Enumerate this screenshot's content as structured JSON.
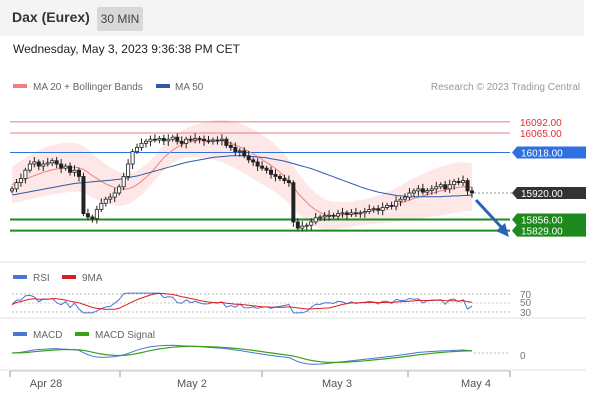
{
  "header": {
    "instrument": "Dax (Eurex)",
    "timeframe": "30 MIN",
    "timestamp": "Wednesday, May 3, 2023 9:36:38 PM CET"
  },
  "legend": {
    "ma20_label": "MA 20 + Bollinger Bands",
    "ma50_label": "MA 50",
    "ma20_color": "#f08080",
    "ma50_color": "#2e5aa8",
    "copyright": "Research © 2023 Trading Central"
  },
  "rsi_panel": {
    "rsi_label": "RSI",
    "ma_label": "9MA",
    "rsi_color": "#4a74d6",
    "ma_color": "#d62020",
    "levels": [
      "70",
      "50",
      "30"
    ]
  },
  "macd_panel": {
    "macd_label": "MACD",
    "signal_label": "MACD Signal",
    "macd_color": "#4a74d6",
    "signal_color": "#3aa01e",
    "zero_label": "0"
  },
  "chart_data": {
    "type": "candlestick",
    "x_ticks": [
      "Apr 28",
      "May 2",
      "May 3",
      "May 4"
    ],
    "y_range": [
      15770,
      16140
    ],
    "last_price": 15920.0,
    "levels": [
      {
        "value": 16092.0,
        "label": "16092.00",
        "kind": "resistance",
        "color": "#e08080"
      },
      {
        "value": 16065.0,
        "label": "16065.00",
        "kind": "resistance",
        "color": "#e08080"
      },
      {
        "value": 16018.0,
        "label": "16018.00",
        "kind": "pivot",
        "color": "#2f6fe0"
      },
      {
        "value": 15920.0,
        "label": "15920.00",
        "kind": "last",
        "color": "#333333"
      },
      {
        "value": 15856.0,
        "label": "15856.00",
        "kind": "support",
        "color": "#1e8a1e"
      },
      {
        "value": 15829.0,
        "label": "15829.00",
        "kind": "support",
        "color": "#1e8a1e"
      }
    ],
    "close": [
      15930,
      15945,
      15955,
      15975,
      15990,
      15995,
      15985,
      15990,
      15993,
      15998,
      15990,
      15980,
      15985,
      15970,
      15975,
      15960,
      15870,
      15862,
      15858,
      15880,
      15895,
      15905,
      15910,
      15920,
      15935,
      15960,
      15990,
      16020,
      16030,
      16040,
      16045,
      16050,
      16048,
      16052,
      16046,
      16050,
      16055,
      16045,
      16040,
      16050,
      16048,
      16052,
      16050,
      16046,
      16045,
      16048,
      16047,
      16050,
      16035,
      16030,
      16020,
      16022,
      16010,
      16000,
      15995,
      15985,
      15980,
      15975,
      15965,
      15960,
      15955,
      15950,
      15945,
      15850,
      15835,
      15840,
      15842,
      15850,
      15860,
      15862,
      15865,
      15866,
      15864,
      15870,
      15872,
      15868,
      15872,
      15870,
      15872,
      15875,
      15880,
      15882,
      15878,
      15885,
      15890,
      15888,
      15900,
      15905,
      15910,
      15920,
      15925,
      15930,
      15922,
      15926,
      15930,
      15935,
      15940,
      15930,
      15940,
      15948,
      15945,
      15950,
      15925,
      15920
    ],
    "ma20": [
      15940,
      15944,
      15948,
      15953,
      15958,
      15962,
      15966,
      15970,
      15973,
      15976,
      15978,
      15980,
      15981,
      15982,
      15982,
      15981,
      15977,
      15970,
      15962,
      15955,
      15948,
      15942,
      15937,
      15933,
      15930,
      15929,
      15930,
      15934,
      15940,
      15948,
      15958,
      15968,
      15980,
      15993,
      16005,
      16015,
      16024,
      16031,
      16037,
      16041,
      16044,
      16046,
      16047,
      16048,
      16048,
      16048,
      16047,
      16046,
      16044,
      16040,
      16036,
      16031,
      16026,
      16020,
      16014,
      16008,
      16001,
      15994,
      15987,
      15979,
      15970,
      15960,
      15948,
      15935,
      15920,
      15908,
      15897,
      15887,
      15879,
      15873,
      15868,
      15866,
      15865,
      15866,
      15867,
      15868,
      15869,
      15871,
      15872,
      15874,
      15876,
      15878,
      15880,
      15882,
      15885,
      15888,
      15891,
      15895,
      15899,
      15903,
      15907,
      15910,
      15913,
      15916,
      15919,
      15922,
      15925,
      15927,
      15930,
      15932,
      15934,
      15935,
      15935,
      15934
    ],
    "ma50": [
      15915,
      15917,
      15919,
      15921,
      15923,
      15925,
      15927,
      15929,
      15931,
      15933,
      15935,
      15937,
      15939,
      15941,
      15943,
      15944,
      15945,
      15946,
      15947,
      15948,
      15949,
      15950,
      15951,
      15952,
      15953,
      15955,
      15957,
      15959,
      15961,
      15964,
      15967,
      15970,
      15973,
      15976,
      15979,
      15982,
      15985,
      15988,
      15991,
      15994,
      15996,
      15998,
      16000,
      16002,
      16004,
      16006,
      16007,
      16008,
      16009,
      16010,
      16010,
      16010,
      16010,
      16009,
      16008,
      16007,
      16006,
      16005,
      16003,
      16001,
      15999,
      15997,
      15994,
      15991,
      15988,
      15985,
      15982,
      15979,
      15975,
      15971,
      15967,
      15963,
      15959,
      15955,
      15951,
      15947,
      15943,
      15939,
      15935,
      15931,
      15928,
      15925,
      15922,
      15920,
      15918,
      15916,
      15914,
      15913,
      15912,
      15911,
      15911,
      15911,
      15911,
      15911,
      15911,
      15911,
      15911,
      15912,
      15912,
      15913,
      15913,
      15914,
      15914,
      15915
    ]
  }
}
